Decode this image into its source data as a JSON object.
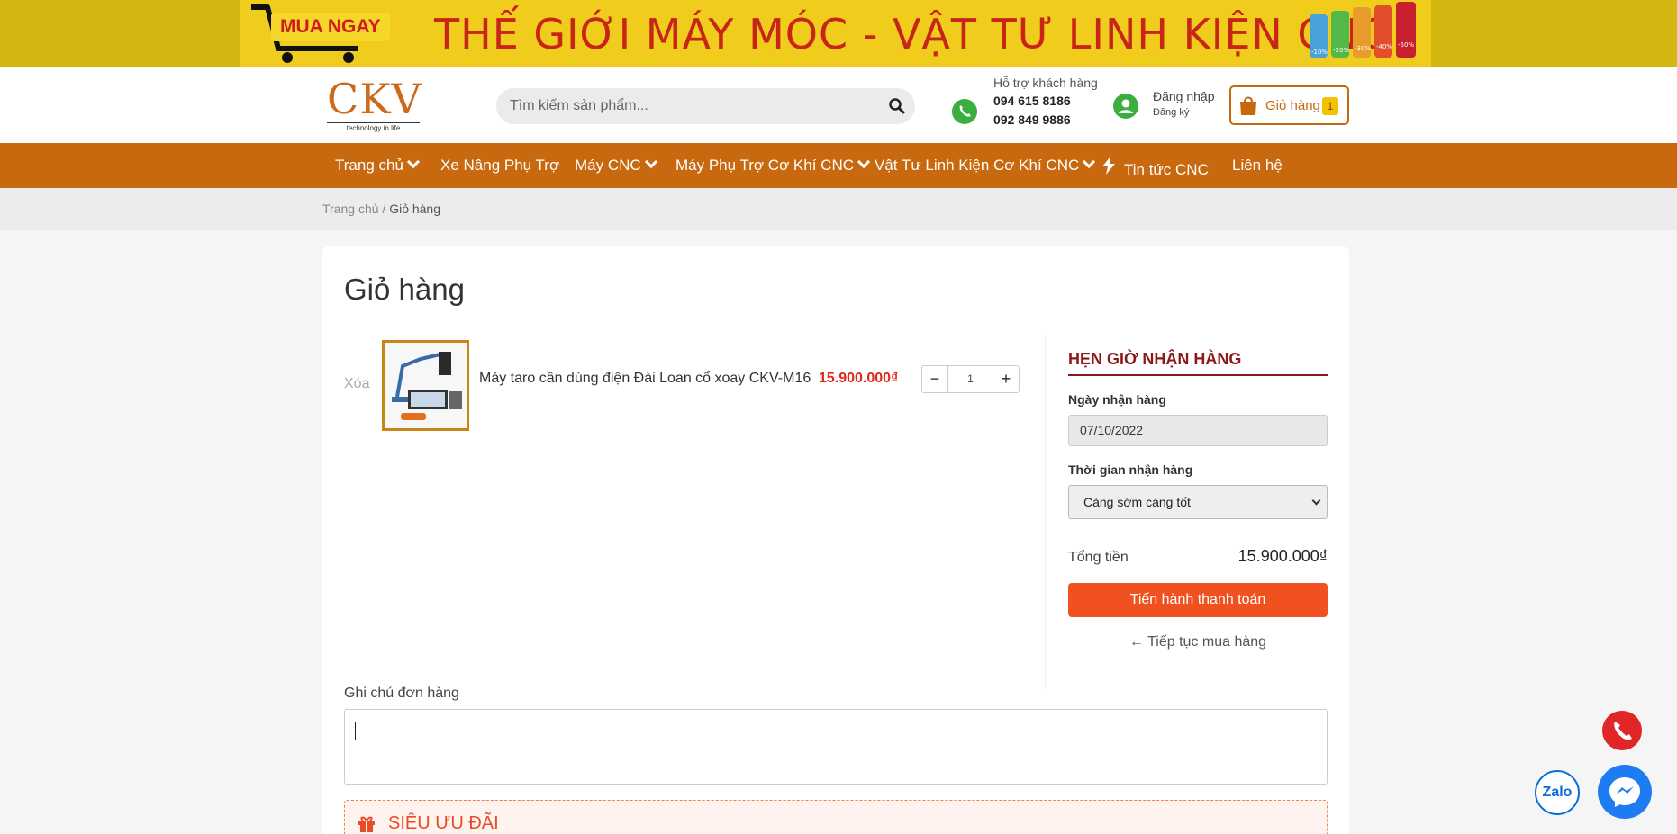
{
  "banner": {
    "cta": "MUA NGAY",
    "headline": "THẾ GIỚI MÁY MÓC - VẬT TƯ LINH KIỆN CNC",
    "discount_tags": [
      "-10%",
      "-20%",
      "-30%",
      "-40%",
      "-50%"
    ]
  },
  "header": {
    "logo_text": "CKV",
    "logo_tagline": "technology in life",
    "search_placeholder": "Tìm kiếm sản phẩm...",
    "support_label": "Hỗ trợ khách hàng",
    "phone_1": "094 615 8186",
    "phone_2": "092 849 9886",
    "login": "Đăng nhập",
    "register": "Đăng ký",
    "cart_label": "Giỏ hàng",
    "cart_count": "1"
  },
  "nav": {
    "items": [
      {
        "label": "Trang chủ"
      },
      {
        "label": "Xe Nâng Phụ Trợ"
      },
      {
        "label": "Máy CNC"
      },
      {
        "label": "Máy Phụ Trợ Cơ Khí CNC"
      },
      {
        "label": "Vật Tư Linh Kiện Cơ Khí CNC"
      },
      {
        "label": "Tin tức CNC"
      },
      {
        "label": "Liên hệ"
      }
    ]
  },
  "breadcrumb": {
    "home": "Trang chủ",
    "separator": "/",
    "current": "Giỏ hàng"
  },
  "cart": {
    "title": "Giỏ hàng",
    "remove_label": "Xóa",
    "item": {
      "name": "Máy taro cần dùng điện Đài Loan cổ xoay CKV-M16",
      "price": "15.900.000₫",
      "quantity": "1",
      "minus": "−",
      "plus": "+"
    },
    "note_label": "Ghi chú đơn hàng",
    "offer_label": "SIÊU ƯU ĐÃI"
  },
  "delivery": {
    "heading": "HẸN GIỜ NHẬN HÀNG",
    "date_label": "Ngày nhận hàng",
    "date_value": "07/10/2022",
    "time_label": "Thời gian nhận hàng",
    "time_value": "Càng sớm càng tốt",
    "total_label": "Tổng tiền",
    "total_value": "15.900.000₫",
    "checkout_label": "Tiến hành thanh toán",
    "continue_label": "← Tiếp tục mua hàng"
  },
  "floating": {
    "zalo_label": "Zalo"
  },
  "colors": {
    "nav_bg": "#c8690f",
    "price": "#e2261b",
    "checkout": "#f0511e",
    "delivery_heading": "#8a1a1a",
    "icon_green": "#3cae3f"
  }
}
